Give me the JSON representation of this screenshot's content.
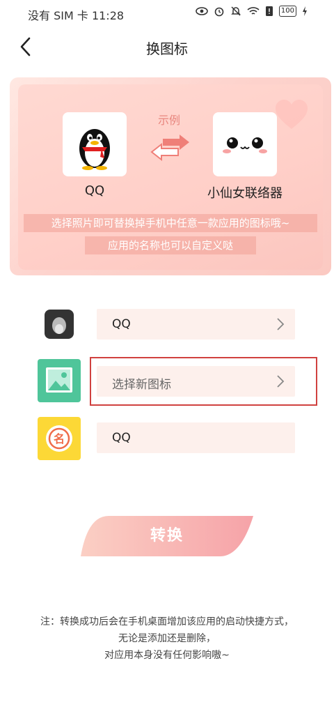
{
  "status_bar": {
    "carrier": "没有 SIM 卡 11:28",
    "battery": "100"
  },
  "header": {
    "title": "换图标"
  },
  "banner": {
    "sample_label": "示例",
    "left_app": "QQ",
    "right_app": "小仙女联络器",
    "slogan_line1": "选择照片即可替换掉手机中任意一款应用的图标哦~",
    "slogan_line2": "应用的名称也可以自定义哒"
  },
  "rows": [
    {
      "label": "QQ",
      "icon": "qq-gray-icon"
    },
    {
      "label": "选择新图标",
      "icon": "image-icon"
    },
    {
      "label": "QQ",
      "icon": "name-tag-icon"
    }
  ],
  "convert_button": {
    "label": "转换"
  },
  "notes": {
    "line1": "注：转换成功后会在手机桌面增加该应用的启动快捷方式，",
    "line2": "无论是添加还是删除，",
    "line3": "对应用本身没有任何影响嗷~"
  },
  "colors": {
    "accent": "#f29b8f",
    "highlight_border": "#d0413f",
    "row_bg": "#fdf0ec"
  }
}
